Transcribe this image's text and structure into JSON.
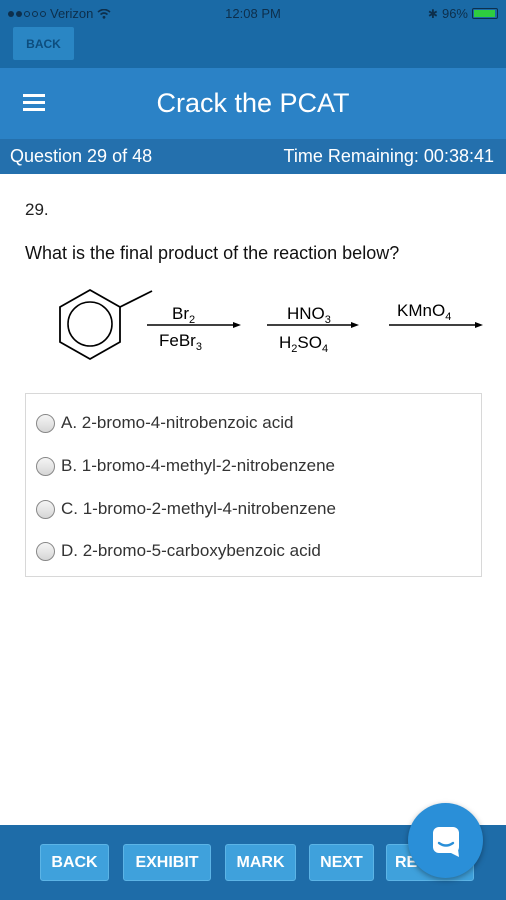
{
  "status_bar": {
    "carrier": "Verizon",
    "time": "12:08 PM",
    "battery": "96%",
    "battery_level": 0.96
  },
  "top": {
    "back_label": "BACK"
  },
  "header": {
    "title": "Crack the PCAT",
    "menu_icon": "hamburger-icon"
  },
  "subheader": {
    "question_progress": "Question 29 of 48",
    "time_remaining": "Time Remaining: 00:38:41"
  },
  "question": {
    "number": "29.",
    "text": "What is the final product of the reaction below?"
  },
  "reaction": {
    "step1_top": "Br",
    "step1_top_sub": "2",
    "step1_bottom": "FeBr",
    "step1_bottom_sub": "3",
    "step2_top": "HNO",
    "step2_top_sub": "3",
    "step2_bottom_a": "H",
    "step2_bottom_sub1": "2",
    "step2_bottom_b": "SO",
    "step2_bottom_sub2": "4",
    "step3_top": "KMnO",
    "step3_top_sub": "4"
  },
  "answers": [
    {
      "label": "A. 2-bromo-4-nitrobenzoic acid"
    },
    {
      "label": "B. 1-bromo-4-methyl-2-nitrobenzene"
    },
    {
      "label": "C. 1-bromo-2-methyl-4-nitrobenzene"
    },
    {
      "label": "D. 2-bromo-5-carboxybenzoic acid"
    }
  ],
  "toolbar": {
    "back": "BACK",
    "exhibit": "EXHIBIT",
    "mark": "MARK",
    "next": "NEXT",
    "review": "RE"
  },
  "colors": {
    "header": "#2b82c6",
    "subheader": "#2470ad",
    "toolbar": "#1e6ca8",
    "button": "#3fa1dc"
  }
}
